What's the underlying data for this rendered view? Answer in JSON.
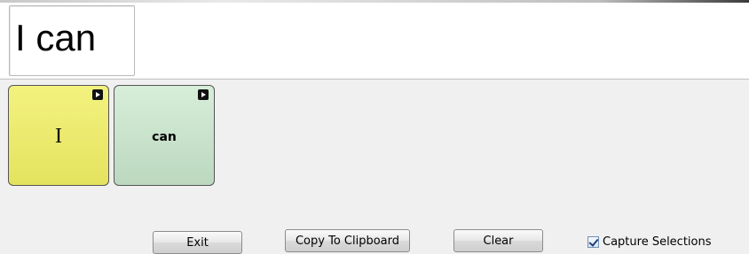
{
  "text_display": {
    "value": "I can"
  },
  "tiles": [
    {
      "label": "I",
      "color": "#eceb70"
    },
    {
      "label": "can",
      "color": "#c9e3cc"
    }
  ],
  "buttons": {
    "exit": "Exit",
    "copy": "Copy To Clipboard",
    "clear": "Clear"
  },
  "capture": {
    "label": "Capture Selections",
    "checked": true
  }
}
